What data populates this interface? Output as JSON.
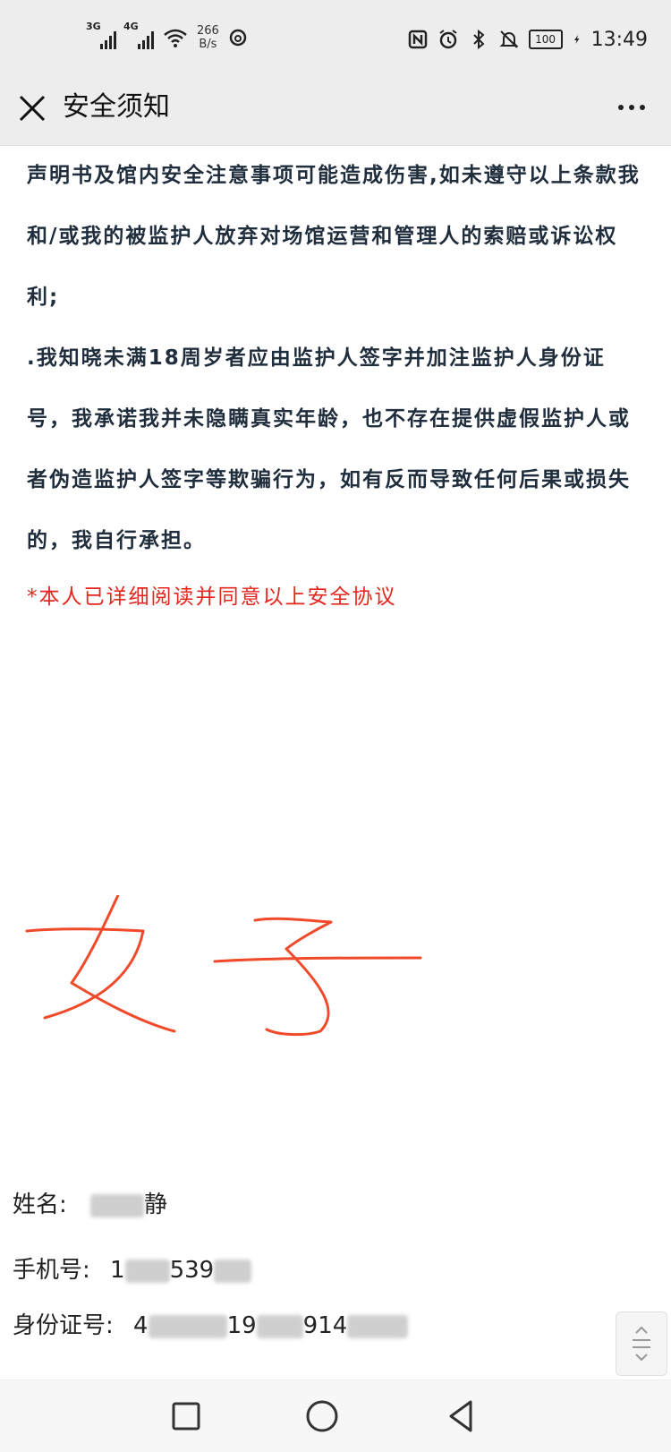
{
  "status_bar": {
    "signal1_tag": "3G",
    "signal2_tag": "4G",
    "speed_value": "266",
    "speed_unit": "B/s",
    "battery": "100",
    "time": "13:49"
  },
  "header": {
    "title": "安全须知"
  },
  "content": {
    "paragraph1": "声明书及馆内安全注意事项可能造成伤害,如未遵守以上条款我和/或我的被监护人放弃对场馆运营和管理人的索赔或诉讼权利;",
    "paragraph2": ".我知晓未满18周岁者应由监护人签字并加注监护人身份证号，我承诺我并未隐瞒真实年龄，也不存在提供虚假监护人或者伪造监护人签字等欺骗行为，如有反而导致任何后果或损失的，我自行承担。",
    "agreement": "*本人已详细阅读并同意以上安全协议"
  },
  "signature": {
    "text": "女子",
    "color": "#f04a2a"
  },
  "fields": {
    "name_label": "姓名:",
    "name_visible": "静",
    "phone_label": "手机号:",
    "phone_part1": "1",
    "phone_part2": "539",
    "id_label": "身份证号:",
    "id_part1": "4",
    "id_part2": "19",
    "id_part3": "914"
  },
  "colors": {
    "accent_red": "#e5261f",
    "text_dark": "#1f2d3d",
    "bar_gray": "#ededed"
  }
}
